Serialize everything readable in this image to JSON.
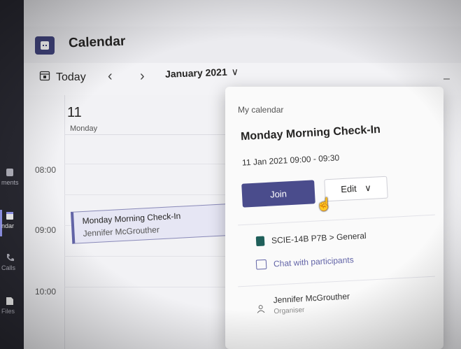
{
  "app": {
    "title": "Calendar"
  },
  "toolbar": {
    "today_label": "Today",
    "prev_label": "‹",
    "next_label": "›",
    "month_label": "January 2021",
    "month_chevron": "∨"
  },
  "rail": {
    "items": [
      {
        "label": "ments",
        "icon": "activity-icon"
      },
      {
        "label": "ndar",
        "icon": "calendar-icon",
        "active": true
      },
      {
        "label": "Calls",
        "icon": "calls-icon"
      },
      {
        "label": "Files",
        "icon": "files-icon"
      }
    ]
  },
  "day": {
    "number": "11",
    "name": "Monday"
  },
  "times": [
    "08:00",
    "09:00",
    "10:00"
  ],
  "event": {
    "title": "Monday Morning Check-In",
    "organiser": "Jennifer McGrouther"
  },
  "card": {
    "context": "My calendar",
    "title": "Monday Morning Check-In",
    "when": "11 Jan 2021 09:00 - 09:30",
    "join_label": "Join",
    "edit_label": "Edit",
    "edit_chevron": "∨",
    "channel": "SCIE-14B P7B > General",
    "chat_label": "Chat with participants",
    "organiser_name": "Jennifer McGrouther",
    "organiser_role": "Organiser"
  },
  "colors": {
    "accent": "#6264a7",
    "join_button": "#4a4c8c",
    "app_icon": "#41447d",
    "rail": "#2a2a33"
  }
}
